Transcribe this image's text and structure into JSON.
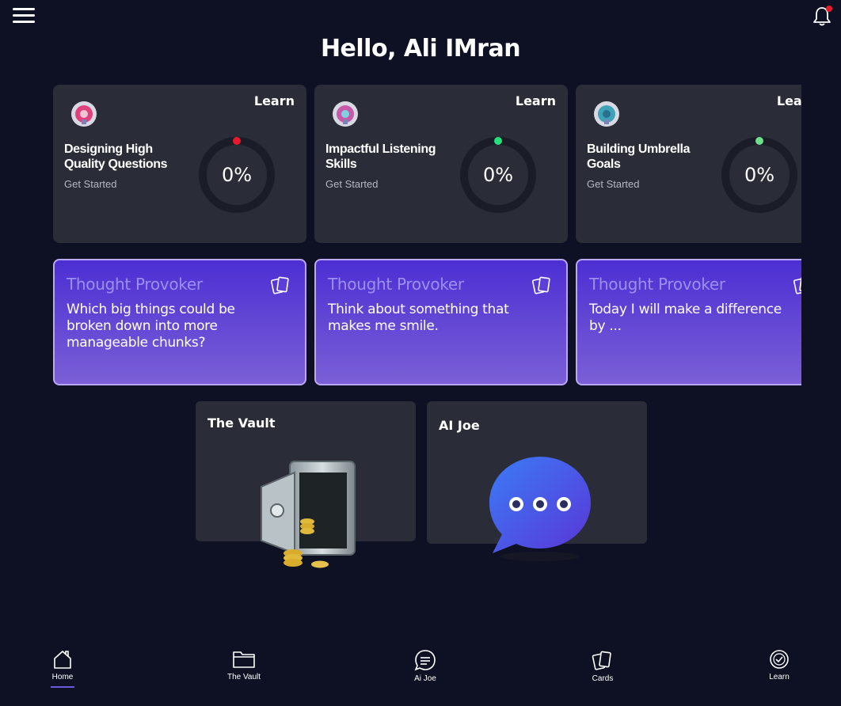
{
  "header": {
    "greeting": "Hello, Ali IMran"
  },
  "learn_cards": [
    {
      "tag": "Learn",
      "title": "Designing High Quality Questions",
      "subtitle": "Get Started",
      "progress": "0%",
      "dot_color": "#e8192c",
      "badge_color": "#e0407c"
    },
    {
      "tag": "Learn",
      "title": "Impactful Listening Skills",
      "subtitle": "Get Started",
      "progress": "0%",
      "dot_color": "#22e07a",
      "badge_color": "#c65aa8"
    },
    {
      "tag": "Learn",
      "title": "Building Umbrella Goals",
      "subtitle": "Get Started",
      "progress": "0%",
      "dot_color": "#6ee08a",
      "badge_color": "#3fa3b8"
    }
  ],
  "thought_cards": [
    {
      "title": "Thought Provoker",
      "body": "Which big things could be broken down into more manageable chunks?"
    },
    {
      "title": "Thought Provoker",
      "body": "Think about something that makes me smile."
    },
    {
      "title": "Thought Provoker",
      "body": "Today I will make a difference by ..."
    }
  ],
  "features": {
    "vault_title": "The Vault",
    "joe_title": "AI Joe"
  },
  "nav": [
    {
      "label": "Home",
      "icon": "home-icon",
      "active": true
    },
    {
      "label": "The Vault",
      "icon": "folder-icon",
      "active": false
    },
    {
      "label": "Ai Joe",
      "icon": "chat-icon",
      "active": false
    },
    {
      "label": "Cards",
      "icon": "cards-icon",
      "active": false
    },
    {
      "label": "Learn",
      "icon": "check-circle-icon",
      "active": false
    }
  ],
  "colors": {
    "background": "#0e1124",
    "card": "#2a2d38",
    "accent": "#6a5ae0",
    "thought_gradient_top": "#4c2fd3",
    "thought_gradient_bottom": "#7a5fd6"
  }
}
